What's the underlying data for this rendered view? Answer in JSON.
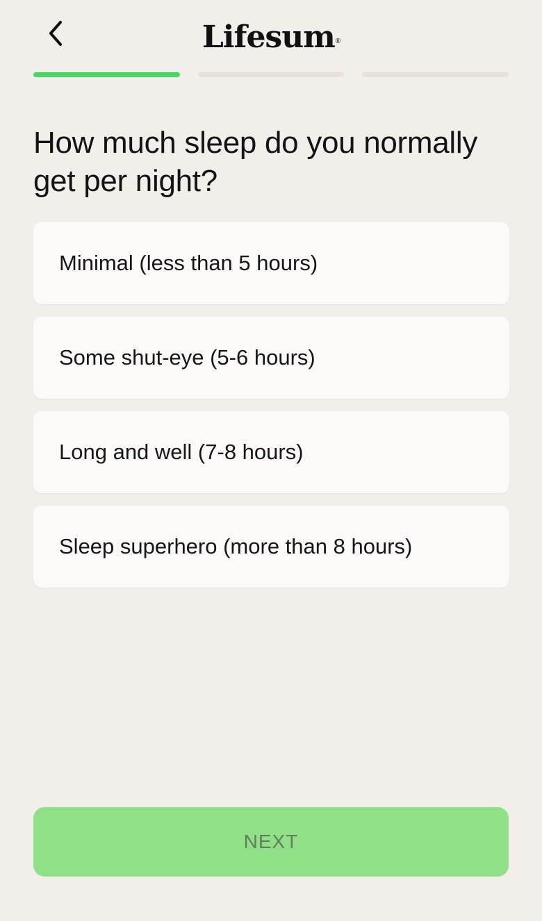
{
  "header": {
    "logo_text": "Lifesum",
    "logo_mark": "®",
    "back_icon": "chevron-left-icon"
  },
  "progress": {
    "total_steps": 3,
    "current_step": 1,
    "active_color": "#4cd464",
    "inactive_color": "#e6e1dc"
  },
  "question": "How much sleep do you normally get per night?",
  "options": [
    {
      "label": "Minimal (less than 5 hours)"
    },
    {
      "label": "Some shut-eye (5-6 hours)"
    },
    {
      "label": "Long and well (7-8 hours)"
    },
    {
      "label": "Sleep superhero (more than 8 hours)"
    }
  ],
  "footer": {
    "next_label": "NEXT",
    "next_color": "#8fe086"
  }
}
